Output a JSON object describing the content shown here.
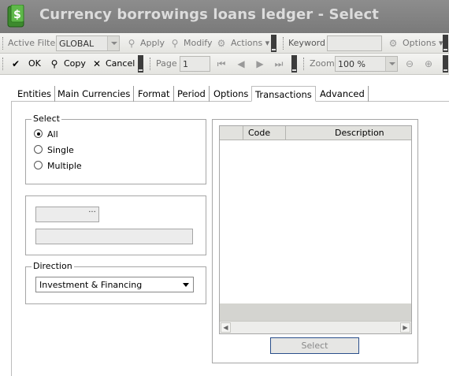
{
  "window": {
    "title": "Currency borrowings loans ledger - Select"
  },
  "toolbar1": {
    "active_filter_label": "Active Filter",
    "active_filter_value": "GLOBAL",
    "apply_label": "Apply",
    "modify_label": "Modify",
    "actions_label": "Actions",
    "keyword_label": "Keyword",
    "keyword_value": "",
    "options_label": "Options"
  },
  "toolbar2": {
    "ok_label": "OK",
    "copy_label": "Copy",
    "cancel_label": "Cancel",
    "page_label": "Page",
    "page_value": "1",
    "zoom_label": "Zoom",
    "zoom_value": "100 %"
  },
  "tabs": [
    {
      "label": "Entities"
    },
    {
      "label": "Main Currencies"
    },
    {
      "label": "Format"
    },
    {
      "label": "Period"
    },
    {
      "label": "Options"
    },
    {
      "label": "Transactions"
    },
    {
      "label": "Advanced"
    }
  ],
  "select_group": {
    "legend": "Select",
    "options": [
      {
        "label": "All",
        "checked": true
      },
      {
        "label": "Single",
        "checked": false
      },
      {
        "label": "Multiple",
        "checked": false
      }
    ]
  },
  "direction_group": {
    "legend": "Direction",
    "value": "Investment & Financing"
  },
  "grid": {
    "columns": [
      "Code",
      "Description"
    ]
  },
  "select_button_label": "Select"
}
